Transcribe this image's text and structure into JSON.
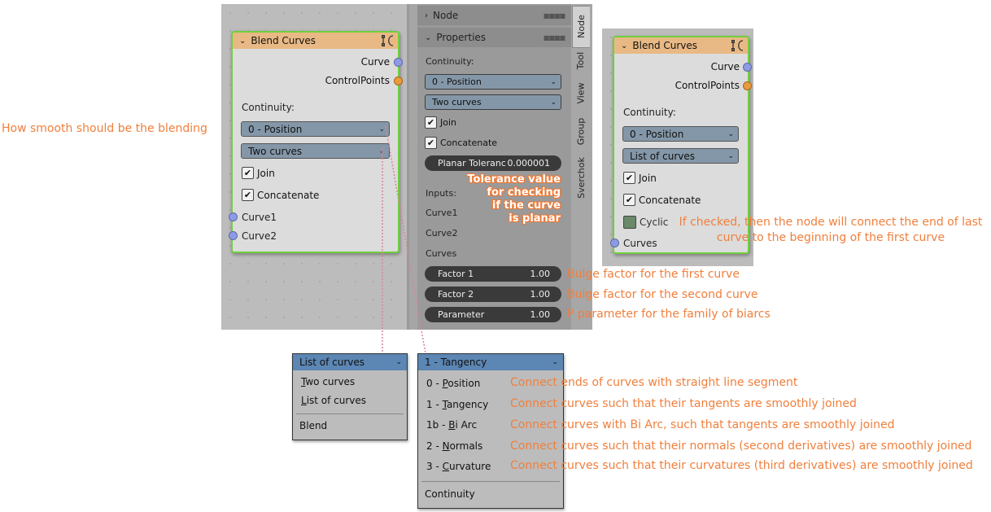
{
  "left_annotation": "How smooth should be the blending",
  "node_left": {
    "title": "Blend Curves",
    "outputs": [
      "Curve",
      "ControlPoints"
    ],
    "continuity_label": "Continuity:",
    "continuity_value": "0 - Position",
    "mode_value": "Two curves",
    "join_label": "Join",
    "concatenate_label": "Concatenate",
    "inputs": [
      "Curve1",
      "Curve2"
    ]
  },
  "panel": {
    "node_header": "Node",
    "properties_header": "Properties",
    "continuity_label": "Continuity:",
    "continuity_value": "0 - Position",
    "mode_value": "Two curves",
    "join_label": "Join",
    "concatenate_label": "Concatenate",
    "planar_label": "Planar Toleranc",
    "planar_value": "0.000001",
    "inputs_label": "Inputs:",
    "input_items": [
      "Curve1",
      "Curve2",
      "Curves"
    ],
    "factor1_label": "Factor 1",
    "factor1_value": "1.00",
    "factor2_label": "Factor 2",
    "factor2_value": "1.00",
    "parameter_label": "Parameter",
    "parameter_value": "1.00"
  },
  "tabs": [
    "Node",
    "Tool",
    "View",
    "Group",
    "Sverchok"
  ],
  "tolerance_annotation": [
    "Tolerance value",
    "for checking",
    "if the curve",
    "is planar"
  ],
  "factor_annotations": {
    "factor1": "Bulge factor for the first curve",
    "factor2": "Bulge factor for the second curve",
    "parameter": "P parameter for the family of biarcs"
  },
  "node_right": {
    "title": "Blend Curves",
    "outputs": [
      "Curve",
      "ControlPoints"
    ],
    "continuity_label": "Continuity:",
    "continuity_value": "0 - Position",
    "mode_value": "List of curves",
    "join_label": "Join",
    "concatenate_label": "Concatenate",
    "cyclic_label": "Cyclic",
    "input": "Curves"
  },
  "cyclic_annotation": [
    "If checked, then the node will connect the end of last",
    "curve to the beginning of the first curve"
  ],
  "mode_menu": {
    "selected": "List of curves",
    "items": [
      {
        "first": "T",
        "rest": "wo curves"
      },
      {
        "first": "L",
        "rest": "ist of curves"
      }
    ],
    "footer": "Blend"
  },
  "continuity_menu": {
    "selected": "1 - Tangency",
    "items": [
      {
        "pre": "0 - ",
        "u": "P",
        "rest": "osition",
        "note": "Connect ends of curves with straight line segment"
      },
      {
        "pre": "1 - ",
        "u": "T",
        "rest": "angency",
        "note": "Connect curves such that their tangents are smoothly joined"
      },
      {
        "pre": "1b - ",
        "u": "B",
        "rest": "i Arc",
        "note": "Connect curves with Bi Arc, such that tangents are smoothly joined"
      },
      {
        "pre": "2 - ",
        "u": "N",
        "rest": "ormals",
        "note": "Connect curves such that their normals (second derivatives) are smoothly joined"
      },
      {
        "pre": "3 - ",
        "u": "C",
        "rest": "urvature",
        "note": "Connect curves such that their curvatures (third derivatives) are smoothly joined"
      }
    ],
    "footer": "Continuity"
  },
  "colors": {
    "annotation": "#f07f3c",
    "node_header": "#e9b985",
    "node_border": "#6fcf3f",
    "dropdown": "#8497a8",
    "menu_header": "#5c86b3"
  }
}
